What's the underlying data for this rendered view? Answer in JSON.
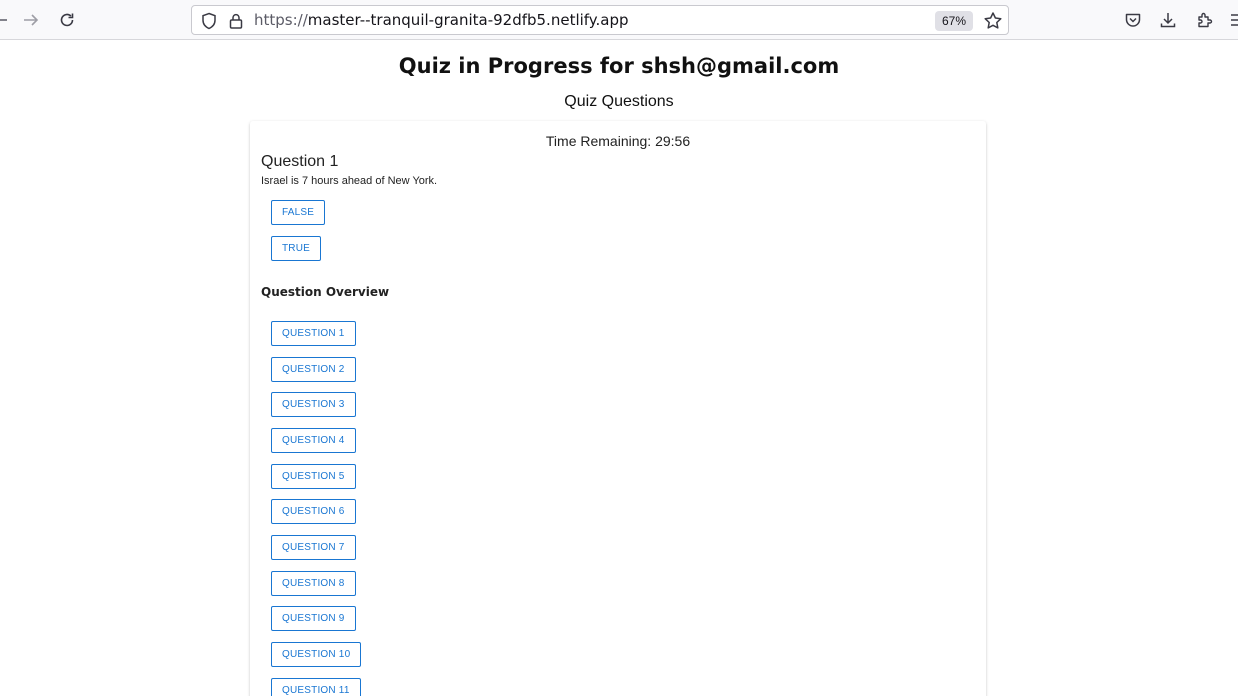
{
  "browser": {
    "url_protocol": "https://",
    "url_host": "master--tranquil-granita-92dfb5.netlify.app",
    "zoom": "67%"
  },
  "page": {
    "title": "Quiz in Progress for shsh@gmail.com",
    "section_title": "Quiz Questions"
  },
  "quiz": {
    "time_remaining": "Time Remaining: 29:56",
    "question_heading": "Question 1",
    "question_text": "Israel is 7 hours ahead of New York.",
    "answers": [
      "FALSE",
      "TRUE"
    ]
  },
  "overview": {
    "title": "Question Overview",
    "buttons": [
      "QUESTION 1",
      "QUESTION 2",
      "QUESTION 3",
      "QUESTION 4",
      "QUESTION 5",
      "QUESTION 6",
      "QUESTION 7",
      "QUESTION 8",
      "QUESTION 9",
      "QUESTION 10",
      "QUESTION 11"
    ]
  },
  "colors": {
    "accent": "#1976d2"
  }
}
